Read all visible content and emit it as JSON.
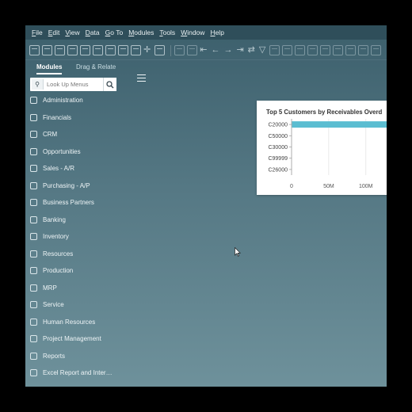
{
  "menubar": {
    "items": [
      "File",
      "Edit",
      "View",
      "Data",
      "Go To",
      "Modules",
      "Tools",
      "Window",
      "Help"
    ]
  },
  "tabs": [
    {
      "label": "Modules",
      "active": true
    },
    {
      "label": "Drag & Relate",
      "active": false
    }
  ],
  "search": {
    "placeholder": "Look Up Menus"
  },
  "sidebar": {
    "items": [
      {
        "label": "Administration",
        "icon": "gear-icon"
      },
      {
        "label": "Financials",
        "icon": "chart-icon"
      },
      {
        "label": "CRM",
        "icon": "crm-icon"
      },
      {
        "label": "Opportunities",
        "icon": "opportunities-icon"
      },
      {
        "label": "Sales - A/R",
        "icon": "tag-icon"
      },
      {
        "label": "Purchasing - A/P",
        "icon": "cart-icon"
      },
      {
        "label": "Business Partners",
        "icon": "partners-icon"
      },
      {
        "label": "Banking",
        "icon": "bank-icon"
      },
      {
        "label": "Inventory",
        "icon": "inventory-icon"
      },
      {
        "label": "Resources",
        "icon": "resources-icon"
      },
      {
        "label": "Production",
        "icon": "production-icon"
      },
      {
        "label": "MRP",
        "icon": "mrp-icon"
      },
      {
        "label": "Service",
        "icon": "service-icon"
      },
      {
        "label": "Human Resources",
        "icon": "person-icon"
      },
      {
        "label": "Project Management",
        "icon": "project-icon"
      },
      {
        "label": "Reports",
        "icon": "reports-icon"
      },
      {
        "label": "Excel Report and Inter…",
        "icon": "excel-icon"
      }
    ]
  },
  "widget": {
    "title": "Top 5 Customers by Receivables Overd"
  },
  "colors": {
    "bar": "#5bbdd1",
    "window_bg": "#4f727e",
    "menubar_bg": "#2f4e5a"
  },
  "chart_data": {
    "type": "bar",
    "orientation": "horizontal",
    "title": "Top 5 Customers by Receivables Overd",
    "categories": [
      "C20000",
      "C50000",
      "C30000",
      "C99999",
      "C26000"
    ],
    "values": [
      160,
      0,
      0,
      0,
      0
    ],
    "x_ticks": [
      "0",
      "50M",
      "100M"
    ],
    "x_tick_values": [
      0,
      50,
      100
    ],
    "xlim": [
      0,
      160
    ]
  }
}
